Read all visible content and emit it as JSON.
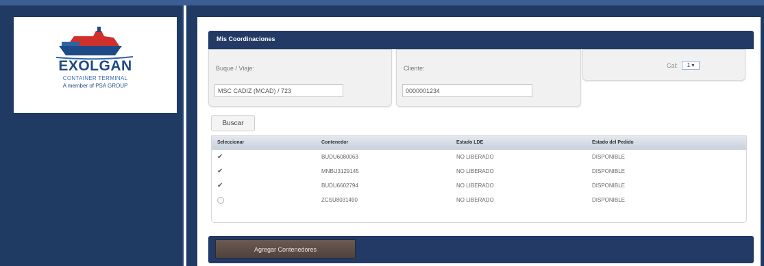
{
  "brand": {
    "name": "EXOLGAN",
    "subtitle": "CONTAINER TERMINAL",
    "tagline": "A member of PSA GROUP"
  },
  "panel": {
    "title": "Mis Coordinaciones"
  },
  "form": {
    "buque_label": "Buque / Viaje:",
    "buque_value": "MSC CADIZ (MCAD) / 723",
    "cliente_label": "Cliente:",
    "cliente_value": "0000001234",
    "cal_label": "Cal:",
    "cal_value": "1 ▾",
    "search_button": "Buscar"
  },
  "table": {
    "columns": [
      "Seleccionar",
      "Contenedor",
      "Estado LDE",
      "Estado del Pedido"
    ],
    "rows": [
      {
        "selected": true,
        "contenedor": "BUDU6080063",
        "estado_lde": "NO LIBERADO",
        "estado_pedido": "DISPONIBLE"
      },
      {
        "selected": true,
        "contenedor": "MNBU3129145",
        "estado_lde": "NO LIBERADO",
        "estado_pedido": "DISPONIBLE"
      },
      {
        "selected": true,
        "contenedor": "BUDU6602794",
        "estado_lde": "NO LIBERADO",
        "estado_pedido": "DISPONIBLE"
      },
      {
        "selected": false,
        "contenedor": "ZCSU8031490",
        "estado_lde": "NO LIBERADO",
        "estado_pedido": "DISPONIBLE"
      }
    ]
  },
  "actions": {
    "add_containers": "Agregar Contenedores"
  },
  "icons": {
    "checked": "checkmark-icon",
    "unchecked": "radio-empty-icon"
  },
  "colors": {
    "navy": "#1f3a63",
    "header_navy": "#223a65",
    "brand_blue": "#1e4a86",
    "brand_red": "#d0302b"
  }
}
